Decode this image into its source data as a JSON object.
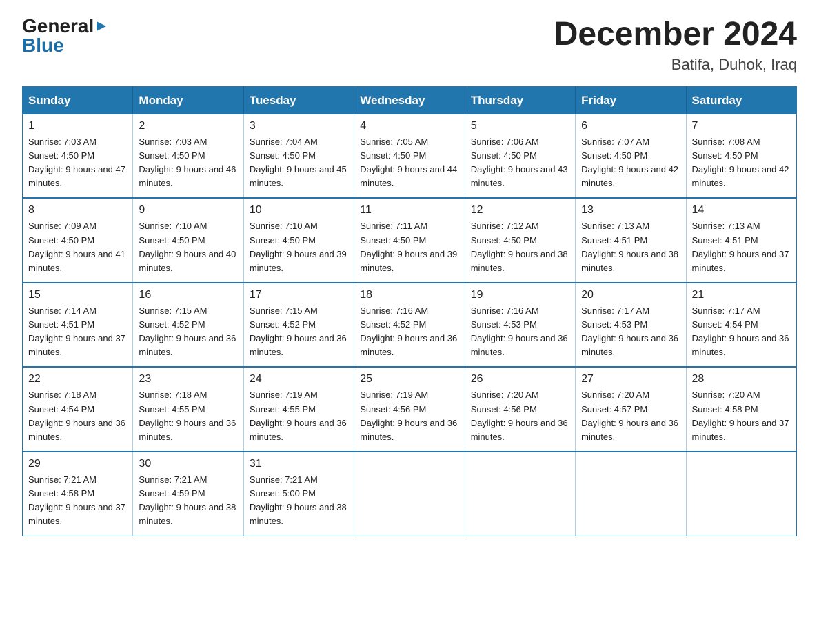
{
  "logo": {
    "general": "General",
    "blue": "Blue",
    "triangle_unicode": "▶"
  },
  "title": "December 2024",
  "subtitle": "Batifa, Duhok, Iraq",
  "weekdays": [
    "Sunday",
    "Monday",
    "Tuesday",
    "Wednesday",
    "Thursday",
    "Friday",
    "Saturday"
  ],
  "weeks": [
    [
      {
        "day": "1",
        "sunrise": "7:03 AM",
        "sunset": "4:50 PM",
        "daylight": "9 hours and 47 minutes."
      },
      {
        "day": "2",
        "sunrise": "7:03 AM",
        "sunset": "4:50 PM",
        "daylight": "9 hours and 46 minutes."
      },
      {
        "day": "3",
        "sunrise": "7:04 AM",
        "sunset": "4:50 PM",
        "daylight": "9 hours and 45 minutes."
      },
      {
        "day": "4",
        "sunrise": "7:05 AM",
        "sunset": "4:50 PM",
        "daylight": "9 hours and 44 minutes."
      },
      {
        "day": "5",
        "sunrise": "7:06 AM",
        "sunset": "4:50 PM",
        "daylight": "9 hours and 43 minutes."
      },
      {
        "day": "6",
        "sunrise": "7:07 AM",
        "sunset": "4:50 PM",
        "daylight": "9 hours and 42 minutes."
      },
      {
        "day": "7",
        "sunrise": "7:08 AM",
        "sunset": "4:50 PM",
        "daylight": "9 hours and 42 minutes."
      }
    ],
    [
      {
        "day": "8",
        "sunrise": "7:09 AM",
        "sunset": "4:50 PM",
        "daylight": "9 hours and 41 minutes."
      },
      {
        "day": "9",
        "sunrise": "7:10 AM",
        "sunset": "4:50 PM",
        "daylight": "9 hours and 40 minutes."
      },
      {
        "day": "10",
        "sunrise": "7:10 AM",
        "sunset": "4:50 PM",
        "daylight": "9 hours and 39 minutes."
      },
      {
        "day": "11",
        "sunrise": "7:11 AM",
        "sunset": "4:50 PM",
        "daylight": "9 hours and 39 minutes."
      },
      {
        "day": "12",
        "sunrise": "7:12 AM",
        "sunset": "4:50 PM",
        "daylight": "9 hours and 38 minutes."
      },
      {
        "day": "13",
        "sunrise": "7:13 AM",
        "sunset": "4:51 PM",
        "daylight": "9 hours and 38 minutes."
      },
      {
        "day": "14",
        "sunrise": "7:13 AM",
        "sunset": "4:51 PM",
        "daylight": "9 hours and 37 minutes."
      }
    ],
    [
      {
        "day": "15",
        "sunrise": "7:14 AM",
        "sunset": "4:51 PM",
        "daylight": "9 hours and 37 minutes."
      },
      {
        "day": "16",
        "sunrise": "7:15 AM",
        "sunset": "4:52 PM",
        "daylight": "9 hours and 36 minutes."
      },
      {
        "day": "17",
        "sunrise": "7:15 AM",
        "sunset": "4:52 PM",
        "daylight": "9 hours and 36 minutes."
      },
      {
        "day": "18",
        "sunrise": "7:16 AM",
        "sunset": "4:52 PM",
        "daylight": "9 hours and 36 minutes."
      },
      {
        "day": "19",
        "sunrise": "7:16 AM",
        "sunset": "4:53 PM",
        "daylight": "9 hours and 36 minutes."
      },
      {
        "day": "20",
        "sunrise": "7:17 AM",
        "sunset": "4:53 PM",
        "daylight": "9 hours and 36 minutes."
      },
      {
        "day": "21",
        "sunrise": "7:17 AM",
        "sunset": "4:54 PM",
        "daylight": "9 hours and 36 minutes."
      }
    ],
    [
      {
        "day": "22",
        "sunrise": "7:18 AM",
        "sunset": "4:54 PM",
        "daylight": "9 hours and 36 minutes."
      },
      {
        "day": "23",
        "sunrise": "7:18 AM",
        "sunset": "4:55 PM",
        "daylight": "9 hours and 36 minutes."
      },
      {
        "day": "24",
        "sunrise": "7:19 AM",
        "sunset": "4:55 PM",
        "daylight": "9 hours and 36 minutes."
      },
      {
        "day": "25",
        "sunrise": "7:19 AM",
        "sunset": "4:56 PM",
        "daylight": "9 hours and 36 minutes."
      },
      {
        "day": "26",
        "sunrise": "7:20 AM",
        "sunset": "4:56 PM",
        "daylight": "9 hours and 36 minutes."
      },
      {
        "day": "27",
        "sunrise": "7:20 AM",
        "sunset": "4:57 PM",
        "daylight": "9 hours and 36 minutes."
      },
      {
        "day": "28",
        "sunrise": "7:20 AM",
        "sunset": "4:58 PM",
        "daylight": "9 hours and 37 minutes."
      }
    ],
    [
      {
        "day": "29",
        "sunrise": "7:21 AM",
        "sunset": "4:58 PM",
        "daylight": "9 hours and 37 minutes."
      },
      {
        "day": "30",
        "sunrise": "7:21 AM",
        "sunset": "4:59 PM",
        "daylight": "9 hours and 38 minutes."
      },
      {
        "day": "31",
        "sunrise": "7:21 AM",
        "sunset": "5:00 PM",
        "daylight": "9 hours and 38 minutes."
      },
      null,
      null,
      null,
      null
    ]
  ],
  "labels": {
    "sunrise": "Sunrise: ",
    "sunset": "Sunset: ",
    "daylight": "Daylight: "
  }
}
